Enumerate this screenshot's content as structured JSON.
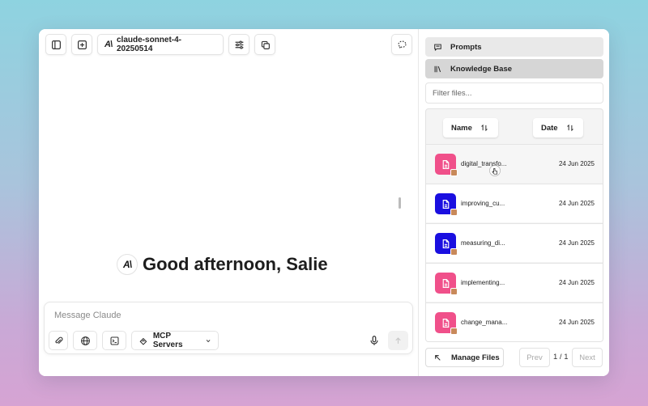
{
  "toolbar": {
    "model_name": "claude-sonnet-4-20250514"
  },
  "greeting": {
    "logo": "A\\",
    "text": "Good afternoon, Salie"
  },
  "composer": {
    "placeholder": "Message Claude",
    "mcp_label": "MCP Servers"
  },
  "sidebar": {
    "nav": [
      {
        "label": "Prompts",
        "icon": "message-square-icon",
        "active": false
      },
      {
        "label": "Knowledge Base",
        "icon": "library-icon",
        "active": true
      }
    ],
    "filter_placeholder": "Filter files...",
    "columns": {
      "name": "Name",
      "date": "Date"
    },
    "files": [
      {
        "name": "digital_transfo...",
        "date": "24 Jun 2025",
        "color": "#f0508a"
      },
      {
        "name": "improving_cu...",
        "date": "24 Jun 2025",
        "color": "#1a0fe0"
      },
      {
        "name": "measuring_di...",
        "date": "24 Jun 2025",
        "color": "#1a0fe0"
      },
      {
        "name": "implementing...",
        "date": "24 Jun 2025",
        "color": "#f0508a"
      },
      {
        "name": "change_mana...",
        "date": "24 Jun 2025",
        "color": "#f0508a"
      }
    ],
    "manage_label": "Manage Files",
    "pager": {
      "prev": "Prev",
      "indicator": "1 / 1",
      "next": "Next"
    }
  }
}
